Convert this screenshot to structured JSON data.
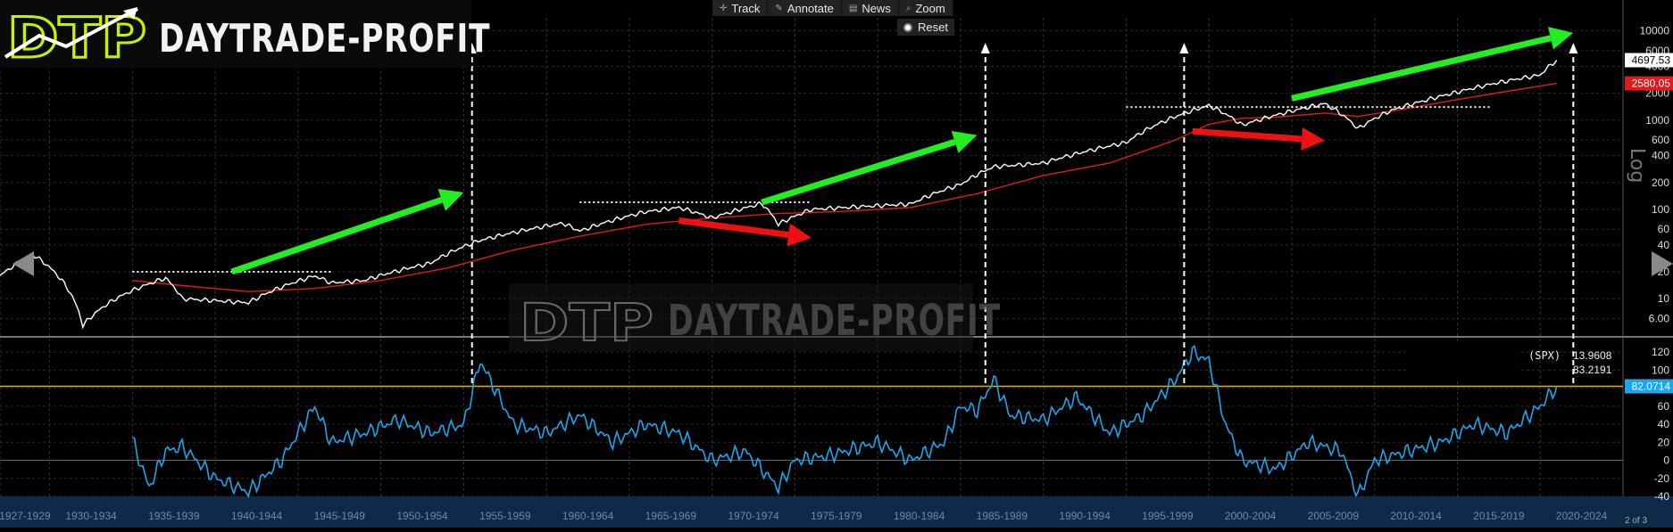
{
  "toolbar": {
    "track_label": "Track",
    "annotate_label": "Annotate",
    "news_label": "News",
    "zoom_label": "Zoom",
    "reset_label": "Reset"
  },
  "branding": {
    "logo_mark": "DTP",
    "logo_text": "DAYTRADE-PROFIT",
    "watermark_text": "DAYTRADE-PROFIT"
  },
  "legend": {
    "symbol": "(SPX)",
    "value_1": "13.9608",
    "value_2": "83.2191"
  },
  "page_indicator": "2 of 3",
  "axis_caption": "Log",
  "colors": {
    "price": "#ffffff",
    "moving_average": "#e01a1a",
    "oscillator": "#1aa7ee",
    "up_arrow": "#22ee22",
    "down_arrow": "#ee1111",
    "threshold": "#e0b020",
    "background": "#000000"
  },
  "chart_data": [
    {
      "type": "line",
      "title": "",
      "scale": "log",
      "ylim": [
        4,
        14000
      ],
      "y_ticks": [
        "10000",
        "6000",
        "4000",
        "2000",
        "1000",
        "600",
        "400",
        "200",
        "100",
        "60",
        "40",
        "20",
        "10",
        "6.00"
      ],
      "price_label": "4697.53",
      "ma_label": "2580.05",
      "series": [
        {
          "name": "",
          "x": [
            1927,
            1929,
            1932,
            1934,
            1937,
            1938,
            1942,
            1946,
            1947,
            1949,
            1953,
            1956,
            1958,
            1961,
            1962,
            1966,
            1968,
            1970,
            1973,
            1974,
            1976,
            1980,
            1982,
            1985,
            1987,
            1990,
            1992,
            1995,
            1998,
            2000,
            2002,
            2004,
            2007,
            2009,
            2011,
            2013,
            2015,
            2018,
            2020,
            2021
          ],
          "y": [
            18,
            31,
            5,
            10,
            17,
            10,
            9,
            18,
            15,
            16,
            25,
            45,
            55,
            70,
            57,
            94,
            105,
            80,
            116,
            68,
            100,
            110,
            115,
            190,
            300,
            330,
            420,
            560,
            1100,
            1460,
            880,
            1130,
            1530,
            800,
            1280,
            1650,
            2060,
            2750,
            3200,
            4697
          ]
        },
        {
          "name": "",
          "x": [
            1935,
            1938,
            1942,
            1946,
            1950,
            1954,
            1958,
            1962,
            1966,
            1970,
            1974,
            1978,
            1982,
            1986,
            1990,
            1994,
            1998,
            2000,
            2002,
            2004,
            2007,
            2009,
            2012,
            2015,
            2018,
            2021
          ],
          "y": [
            16,
            14,
            12,
            13,
            16,
            22,
            35,
            50,
            68,
            80,
            90,
            95,
            105,
            150,
            240,
            330,
            600,
            900,
            1050,
            1080,
            1200,
            1100,
            1350,
            1700,
            2100,
            2580
          ]
        }
      ]
    },
    {
      "type": "line",
      "title": "",
      "ylim": [
        -40,
        130
      ],
      "y_ticks": [
        "120",
        "100",
        "80",
        "60",
        "40",
        "20",
        "0",
        "-20",
        "-40"
      ],
      "current_label": "82.0714",
      "threshold": 82.07,
      "series": [
        {
          "name": "",
          "x": [
            1935,
            1936,
            1937,
            1938,
            1940,
            1942,
            1944,
            1946,
            1947,
            1949,
            1951,
            1953,
            1955,
            1956,
            1958,
            1960,
            1962,
            1964,
            1966,
            1968,
            1970,
            1972,
            1974,
            1975,
            1977,
            1980,
            1982,
            1984,
            1985,
            1986,
            1987,
            1988,
            1990,
            1992,
            1994,
            1996,
            1998,
            1999,
            2000,
            2001,
            2002,
            2004,
            2006,
            2008,
            2009,
            2010,
            2012,
            2014,
            2016,
            2018,
            2020,
            2021
          ],
          "y": [
            22,
            -30,
            10,
            15,
            -20,
            -35,
            0,
            60,
            20,
            30,
            45,
            30,
            40,
            110,
            40,
            30,
            50,
            20,
            40,
            30,
            0,
            10,
            -30,
            0,
            5,
            20,
            0,
            20,
            60,
            55,
            90,
            50,
            45,
            70,
            30,
            50,
            90,
            120,
            110,
            40,
            0,
            -10,
            20,
            10,
            -40,
            0,
            10,
            20,
            40,
            30,
            60,
            82
          ]
        }
      ]
    }
  ],
  "x_axis": {
    "categories": [
      "1927-1929",
      "1930-1934",
      "1935-1939",
      "1940-1944",
      "1945-1949",
      "1950-1954",
      "1955-1959",
      "1960-1964",
      "1965-1969",
      "1970-1974",
      "1975-1979",
      "1980-1984",
      "1985-1989",
      "1990-1994",
      "1995-1999",
      "2000-2004",
      "2005-2009",
      "2010-2014",
      "2015-2019",
      "2020-2024"
    ]
  }
}
